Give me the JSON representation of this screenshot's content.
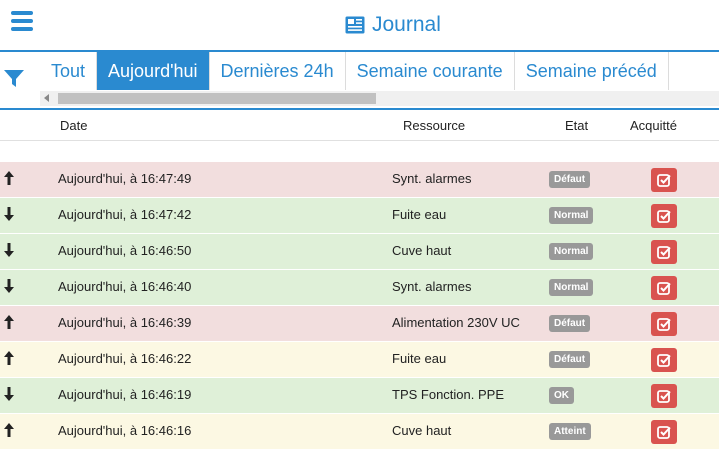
{
  "header": {
    "title": "Journal"
  },
  "tabs": [
    {
      "label": "Tout",
      "active": false
    },
    {
      "label": "Aujourd'hui",
      "active": true
    },
    {
      "label": "Dernières 24h",
      "active": false
    },
    {
      "label": "Semaine courante",
      "active": false
    },
    {
      "label": "Semaine précéd",
      "active": false
    }
  ],
  "columns": {
    "date": "Date",
    "resource": "Ressource",
    "state": "Etat",
    "ack": "Acquitté"
  },
  "colors": {
    "accent": "#2a8ad0",
    "row_red": "#f2dede",
    "row_green": "#dff0d8",
    "row_yellow": "#fcf8e3",
    "ack_button": "#d9534f",
    "badge": "#999999"
  },
  "rows": [
    {
      "direction": "up",
      "date": "Aujourd'hui, à 16:47:49",
      "resource": "Synt. alarmes",
      "state": "Défaut",
      "color": "red"
    },
    {
      "direction": "down",
      "date": "Aujourd'hui, à 16:47:42",
      "resource": "Fuite eau",
      "state": "Normal",
      "color": "green"
    },
    {
      "direction": "down",
      "date": "Aujourd'hui, à 16:46:50",
      "resource": "Cuve haut",
      "state": "Normal",
      "color": "green"
    },
    {
      "direction": "down",
      "date": "Aujourd'hui, à 16:46:40",
      "resource": "Synt. alarmes",
      "state": "Normal",
      "color": "green"
    },
    {
      "direction": "up",
      "date": "Aujourd'hui, à 16:46:39",
      "resource": "Alimentation 230V UC",
      "state": "Défaut",
      "color": "red"
    },
    {
      "direction": "up",
      "date": "Aujourd'hui, à 16:46:22",
      "resource": "Fuite eau",
      "state": "Défaut",
      "color": "yellow"
    },
    {
      "direction": "down",
      "date": "Aujourd'hui, à 16:46:19",
      "resource": "TPS Fonction. PPE",
      "state": "OK",
      "color": "green"
    },
    {
      "direction": "up",
      "date": "Aujourd'hui, à 16:46:16",
      "resource": "Cuve haut",
      "state": "Atteint",
      "color": "yellow"
    }
  ]
}
